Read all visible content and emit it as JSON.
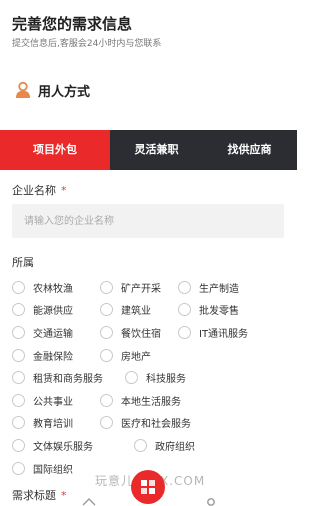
{
  "header": {
    "title": "完善您的需求信息",
    "subtitle": "提交信息后,客服会24小时内与您联系"
  },
  "section": {
    "title": "用人方式"
  },
  "tabs": [
    {
      "label": "项目外包",
      "active": true
    },
    {
      "label": "灵活兼职",
      "active": false
    },
    {
      "label": "找供应商",
      "active": false
    }
  ],
  "company_field": {
    "label": "企业名称",
    "required_mark": "*",
    "placeholder": "请输入您的企业名称"
  },
  "industry_field": {
    "label": "所属",
    "options": [
      [
        "农林牧渔",
        "矿产开采",
        "生产制造"
      ],
      [
        "能源供应",
        "建筑业",
        "批发零售"
      ],
      [
        "交通运输",
        "餐饮住宿",
        "IT通讯服务"
      ],
      [
        "金融保险",
        "房地产"
      ],
      [
        "租赁和商务服务",
        "科技服务"
      ],
      [
        "公共事业",
        "本地生活服务"
      ],
      [
        "教育培训",
        "医疗和社会服务"
      ],
      [
        "文体娱乐服务",
        "政府组织"
      ],
      [
        "国际组织"
      ]
    ]
  },
  "demand_title_field": {
    "label": "需求标题",
    "required_mark": "*"
  },
  "watermark": "玩意儿 WYX.COM",
  "colors": {
    "accent": "#ea2a2a",
    "tab_bar": "#2b2d33",
    "icon_orange": "#e8894a"
  }
}
